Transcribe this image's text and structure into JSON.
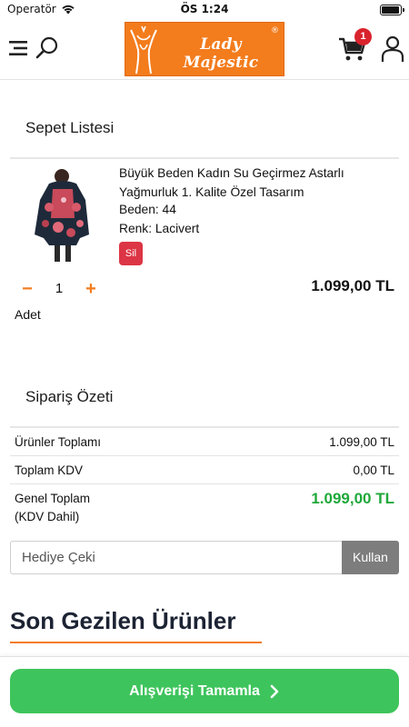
{
  "status_bar": {
    "carrier": "Operatör",
    "time": "ÖS 1:24",
    "battery_level": 1.0
  },
  "header": {
    "logo_text": "Lady Majestic",
    "logo_reg": "®",
    "cart_count": "1",
    "brand_color": "#f37c1d",
    "icons": [
      "menu-icon",
      "search-icon",
      "cart-icon",
      "user-icon"
    ]
  },
  "cart": {
    "title": "Sepet Listesi",
    "item": {
      "name": "Büyük Beden Kadın Su Geçirmez Astarlı Yağmurluk 1. Kalite Özel Tasarım",
      "size": "Beden: 44",
      "color": "Renk: Lacivert",
      "delete_label": "Sil",
      "minus_label": "−",
      "plus_label": "+",
      "quantity": "1",
      "quantity_label": "Adet",
      "price": "1.099,00 TL"
    }
  },
  "summary": {
    "title": "Sipariş Özeti",
    "rows": [
      {
        "label": "Ürünler Toplamı",
        "value": "1.099,00 TL"
      },
      {
        "label": "Toplam KDV",
        "value": "0,00 TL"
      }
    ],
    "grand_label_1": "Genel Toplam",
    "grand_label_2": "(KDV Dahil)",
    "grand_value": "1.099,00 TL",
    "grand_color": "#1fa83a"
  },
  "coupon": {
    "placeholder": "Hediye Çeki",
    "button_label": "Kullan"
  },
  "recent": {
    "title": "Son Gezilen Ürünler"
  },
  "checkout": {
    "label": "Alışverişi Tamamla",
    "color": "#3ec45c"
  }
}
